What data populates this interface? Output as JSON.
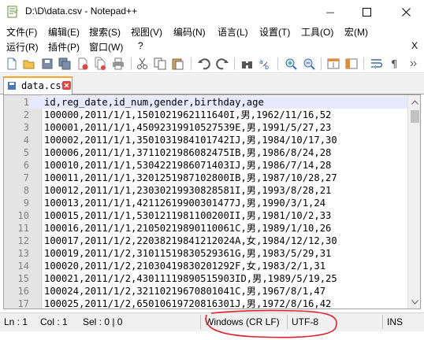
{
  "window": {
    "title": "D:\\D\\data.csv - Notepad++",
    "minimize_glyph": "—",
    "maximize_glyph": "☐",
    "close_glyph": "✕"
  },
  "menu": {
    "row1": [
      "文件(F)",
      "编辑(E)",
      "搜索(S)",
      "视图(V)",
      "编码(N)",
      "语言(L)",
      "设置(T)",
      "工具(O)",
      "宏(M)"
    ],
    "row2": [
      "运行(R)",
      "插件(P)",
      "窗口(W)",
      "?"
    ],
    "close_label": "X"
  },
  "toolbar": {
    "icons": [
      "new-file-icon",
      "open-file-icon",
      "save-icon",
      "save-all-icon",
      "close-file-icon",
      "close-all-icon",
      "print-icon",
      "cut-icon",
      "copy-icon",
      "paste-icon",
      "undo-icon",
      "redo-icon",
      "find-icon",
      "replace-icon",
      "zoom-in-icon",
      "zoom-out-icon",
      "sync-vertical-icon",
      "sync-horizontal-icon",
      "word-wrap-icon",
      "show-all-chars-icon"
    ]
  },
  "tabs": [
    {
      "label": "data.csv",
      "icon": "file-icon",
      "close_icon": "tab-close-icon"
    }
  ],
  "editor": {
    "lines": [
      {
        "num": "1",
        "text": "id,reg_date,id_num,gender,birthday,age"
      },
      {
        "num": "2",
        "text": "100000,2011/1/1,1501021962111640I,男,1962/11/16,52"
      },
      {
        "num": "3",
        "text": "100001,2011/1/1,45092319910527539E,男,1991/5/27,23"
      },
      {
        "num": "4",
        "text": "100002,2011/1/1,3501031984101742IJ,男,1984/10/17,30"
      },
      {
        "num": "5",
        "text": "100006,2011/1/1,3711021986082475IB,男,1986/8/24,28"
      },
      {
        "num": "6",
        "text": "100010,2011/1/1,5304221986071403IJ,男,1986/7/14,28"
      },
      {
        "num": "7",
        "text": "100011,2011/1/1,3201251987102800IB,男,1987/10/28,27"
      },
      {
        "num": "8",
        "text": "100012,2011/1/1,23030219930828581I,男,1993/8/28,21"
      },
      {
        "num": "9",
        "text": "100013,2011/1/1,42112619900301477J,男,1990/3/1,24"
      },
      {
        "num": "10",
        "text": "100015,2011/1/1,5301211981100200II,男,1981/10/2,33"
      },
      {
        "num": "11",
        "text": "100016,2011/1/1,21050219890110061C,男,1989/1/10,26"
      },
      {
        "num": "12",
        "text": "100017,2011/1/2,22038219841212024A,女,1984/12/12,30"
      },
      {
        "num": "13",
        "text": "100019,2011/1/2,31011519830529361G,男,1983/5/29,31"
      },
      {
        "num": "14",
        "text": "100020,2011/1/2,21030419830201292F,女,1983/2/1,31"
      },
      {
        "num": "15",
        "text": "100021,2011/1/2,43011119890515903ID,男,1989/5/19,25"
      },
      {
        "num": "16",
        "text": "100024,2011/1/2,32110219670801041C,男,1967/8/1,47"
      },
      {
        "num": "17",
        "text": "100025,2011/1/2,65010619720816301J,男,1972/8/16,42"
      }
    ],
    "current_line": 1
  },
  "statusbar": {
    "ln": "Ln : 1",
    "col": "Col : 1",
    "sel": "Sel : 0 | 0",
    "eol": "Windows (CR LF)",
    "encoding": "UTF-8",
    "mode": "INS"
  },
  "colors": {
    "tab_accent": "#f5a623",
    "tab_close": "#e04343",
    "annotation_red": "#e0202a",
    "gutter": "#e4e4e4",
    "current_line": "#e8e8ff"
  }
}
